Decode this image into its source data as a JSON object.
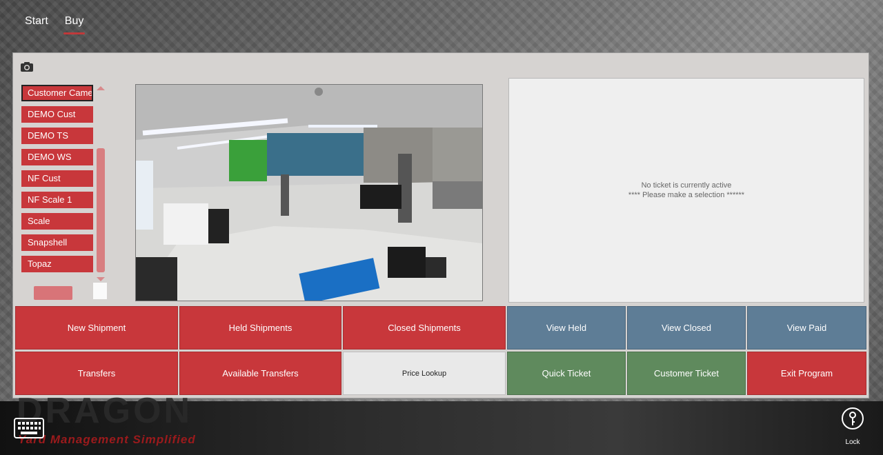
{
  "nav": {
    "tabs": [
      {
        "label": "Start",
        "active": false
      },
      {
        "label": "Buy",
        "active": true
      }
    ]
  },
  "camera_list": {
    "items": [
      {
        "label": "Customer Camera",
        "selected": true
      },
      {
        "label": "DEMO Cust"
      },
      {
        "label": "DEMO TS"
      },
      {
        "label": "DEMO WS"
      },
      {
        "label": "NF Cust"
      },
      {
        "label": "NF Scale 1"
      },
      {
        "label": "Scale"
      },
      {
        "label": "Snapshell"
      },
      {
        "label": "Topaz"
      }
    ]
  },
  "ticket": {
    "line1": "No ticket is currently active",
    "line2": "**** Please make a selection ******"
  },
  "actions": {
    "new_shipment": "New Shipment",
    "held_shipments": "Held Shipments",
    "closed_shipments": "Closed Shipments",
    "view_held": "View Held",
    "view_closed": "View Closed",
    "view_paid": "View Paid",
    "transfers": "Transfers",
    "available_transfers": "Available Transfers",
    "price_lookup": "Price Lookup",
    "quick_ticket": "Quick Ticket",
    "customer_ticket": "Customer Ticket",
    "exit_program": "Exit Program"
  },
  "branding": {
    "logo": "DRAGON",
    "tagline": "Yard Management Simplified"
  },
  "footer": {
    "lock_label": "Lock"
  },
  "colors": {
    "red": "#c8373b",
    "blue": "#5e7d96",
    "green": "#5f8a5d",
    "panel": "#d6d3d1"
  }
}
